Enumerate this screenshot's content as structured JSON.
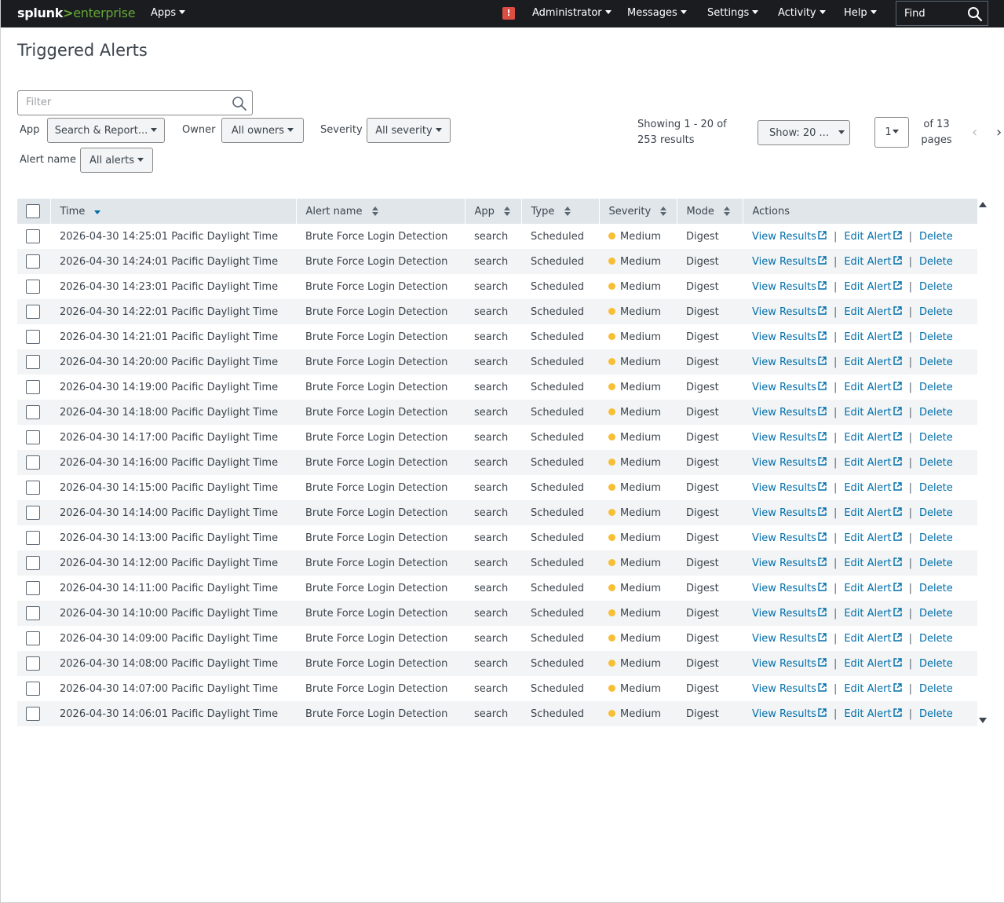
{
  "topbar": {
    "logo_splunk": "splunk",
    "logo_gt": ">",
    "logo_enterprise": "enterprise",
    "apps": "Apps",
    "administrator": "Administrator",
    "messages": "Messages",
    "settings": "Settings",
    "activity": "Activity",
    "help": "Help",
    "find": "Find",
    "alert_badge": "!"
  },
  "page": {
    "title": "Triggered Alerts"
  },
  "filters": {
    "filter_placeholder": "Filter",
    "app_label": "App",
    "app_value": "Search & Report...",
    "owner_label": "Owner",
    "owner_value": "All owners",
    "severity_label": "Severity",
    "severity_value": "All severity",
    "alert_name_label": "Alert name",
    "alert_name_value": "All alerts"
  },
  "pagination": {
    "showing_line1": "Showing 1 - 20 of",
    "showing_line2": "253 results",
    "show_count": "Show: 20 ...",
    "current_page": "1",
    "of_line1": "of 13",
    "of_line2": "pages",
    "prev": "‹",
    "next": "›"
  },
  "table": {
    "headers": {
      "time": "Time",
      "alert_name": "Alert name",
      "app": "App",
      "type": "Type",
      "severity": "Severity",
      "mode": "Mode",
      "actions": "Actions"
    },
    "actions": {
      "view": "View Results",
      "edit": "Edit Alert",
      "delete": "Delete",
      "sep": "|"
    },
    "severity_color": "#f8be34",
    "link_color": "#006eaa",
    "rows": [
      {
        "time": "2026-04-30 14:25:01 Pacific Daylight Time",
        "alert": "Brute Force Login Detection",
        "app": "search",
        "type": "Scheduled",
        "severity": "Medium",
        "mode": "Digest"
      },
      {
        "time": "2026-04-30 14:24:01 Pacific Daylight Time",
        "alert": "Brute Force Login Detection",
        "app": "search",
        "type": "Scheduled",
        "severity": "Medium",
        "mode": "Digest"
      },
      {
        "time": "2026-04-30 14:23:01 Pacific Daylight Time",
        "alert": "Brute Force Login Detection",
        "app": "search",
        "type": "Scheduled",
        "severity": "Medium",
        "mode": "Digest"
      },
      {
        "time": "2026-04-30 14:22:01 Pacific Daylight Time",
        "alert": "Brute Force Login Detection",
        "app": "search",
        "type": "Scheduled",
        "severity": "Medium",
        "mode": "Digest"
      },
      {
        "time": "2026-04-30 14:21:01 Pacific Daylight Time",
        "alert": "Brute Force Login Detection",
        "app": "search",
        "type": "Scheduled",
        "severity": "Medium",
        "mode": "Digest"
      },
      {
        "time": "2026-04-30 14:20:00 Pacific Daylight Time",
        "alert": "Brute Force Login Detection",
        "app": "search",
        "type": "Scheduled",
        "severity": "Medium",
        "mode": "Digest"
      },
      {
        "time": "2026-04-30 14:19:00 Pacific Daylight Time",
        "alert": "Brute Force Login Detection",
        "app": "search",
        "type": "Scheduled",
        "severity": "Medium",
        "mode": "Digest"
      },
      {
        "time": "2026-04-30 14:18:00 Pacific Daylight Time",
        "alert": "Brute Force Login Detection",
        "app": "search",
        "type": "Scheduled",
        "severity": "Medium",
        "mode": "Digest"
      },
      {
        "time": "2026-04-30 14:17:00 Pacific Daylight Time",
        "alert": "Brute Force Login Detection",
        "app": "search",
        "type": "Scheduled",
        "severity": "Medium",
        "mode": "Digest"
      },
      {
        "time": "2026-04-30 14:16:00 Pacific Daylight Time",
        "alert": "Brute Force Login Detection",
        "app": "search",
        "type": "Scheduled",
        "severity": "Medium",
        "mode": "Digest"
      },
      {
        "time": "2026-04-30 14:15:00 Pacific Daylight Time",
        "alert": "Brute Force Login Detection",
        "app": "search",
        "type": "Scheduled",
        "severity": "Medium",
        "mode": "Digest"
      },
      {
        "time": "2026-04-30 14:14:00 Pacific Daylight Time",
        "alert": "Brute Force Login Detection",
        "app": "search",
        "type": "Scheduled",
        "severity": "Medium",
        "mode": "Digest"
      },
      {
        "time": "2026-04-30 14:13:00 Pacific Daylight Time",
        "alert": "Brute Force Login Detection",
        "app": "search",
        "type": "Scheduled",
        "severity": "Medium",
        "mode": "Digest"
      },
      {
        "time": "2026-04-30 14:12:00 Pacific Daylight Time",
        "alert": "Brute Force Login Detection",
        "app": "search",
        "type": "Scheduled",
        "severity": "Medium",
        "mode": "Digest"
      },
      {
        "time": "2026-04-30 14:11:00 Pacific Daylight Time",
        "alert": "Brute Force Login Detection",
        "app": "search",
        "type": "Scheduled",
        "severity": "Medium",
        "mode": "Digest"
      },
      {
        "time": "2026-04-30 14:10:00 Pacific Daylight Time",
        "alert": "Brute Force Login Detection",
        "app": "search",
        "type": "Scheduled",
        "severity": "Medium",
        "mode": "Digest"
      },
      {
        "time": "2026-04-30 14:09:00 Pacific Daylight Time",
        "alert": "Brute Force Login Detection",
        "app": "search",
        "type": "Scheduled",
        "severity": "Medium",
        "mode": "Digest"
      },
      {
        "time": "2026-04-30 14:08:00 Pacific Daylight Time",
        "alert": "Brute Force Login Detection",
        "app": "search",
        "type": "Scheduled",
        "severity": "Medium",
        "mode": "Digest"
      },
      {
        "time": "2026-04-30 14:07:00 Pacific Daylight Time",
        "alert": "Brute Force Login Detection",
        "app": "search",
        "type": "Scheduled",
        "severity": "Medium",
        "mode": "Digest"
      },
      {
        "time": "2026-04-30 14:06:01 Pacific Daylight Time",
        "alert": "Brute Force Login Detection",
        "app": "search",
        "type": "Scheduled",
        "severity": "Medium",
        "mode": "Digest"
      }
    ]
  }
}
